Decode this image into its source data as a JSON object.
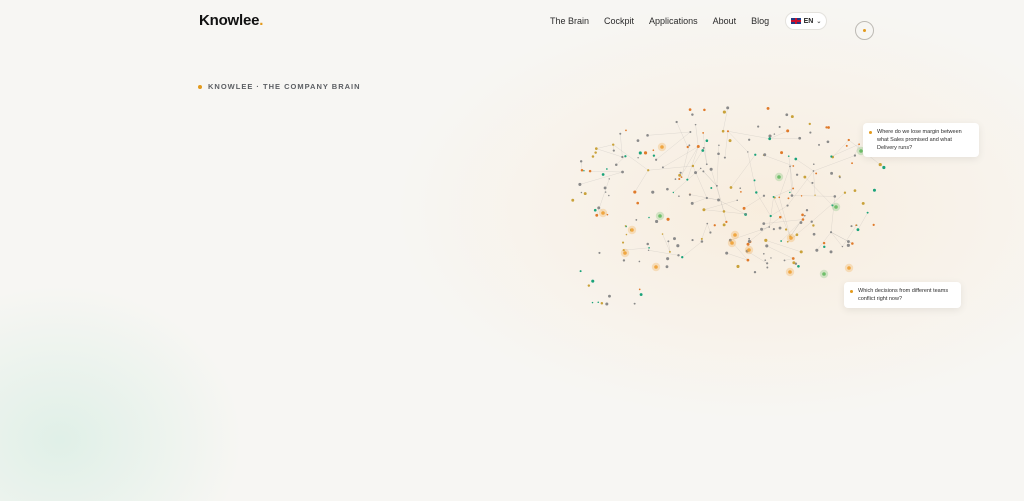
{
  "header": {
    "logo_text": "Knowlee",
    "logo_dot": ".",
    "nav": [
      "The Brain",
      "Cockpit",
      "Applications",
      "About",
      "Blog"
    ],
    "language": "EN"
  },
  "hero": {
    "eyebrow": "KNOWLEE · THE COMPANY BRAIN"
  },
  "questions": [
    "Where do we lose margin between what Sales promised and what Delivery runs?",
    "Which decisions from different teams conflict right now?"
  ],
  "icons": {
    "flag": "uk-flag-icon",
    "chevron": "chevron-down-icon",
    "toggle": "dot-toggle-icon"
  },
  "colors": {
    "accent": "#e39a1c",
    "green": "#5fb86a",
    "teal": "#1aa37a",
    "background": "#f7f6f3"
  }
}
